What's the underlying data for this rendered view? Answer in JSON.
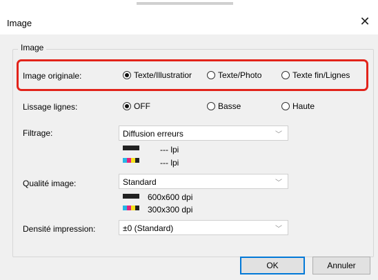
{
  "window": {
    "title": "Image",
    "close_glyph": "✕"
  },
  "group": {
    "title": "Image"
  },
  "image_originale": {
    "label": "Image originale:",
    "options": [
      {
        "label": "Texte/Illustratior",
        "selected": true
      },
      {
        "label": "Texte/Photo",
        "selected": false
      },
      {
        "label": "Texte fin/Lignes",
        "selected": false
      }
    ]
  },
  "lissage": {
    "label": "Lissage lignes:",
    "options": [
      {
        "label": "OFF",
        "selected": true
      },
      {
        "label": "Basse",
        "selected": false
      },
      {
        "label": "Haute",
        "selected": false
      }
    ]
  },
  "filtrage": {
    "label": "Filtrage:",
    "value": "Diffusion erreurs",
    "mono_lpi": "--- lpi",
    "color_lpi": "--- lpi"
  },
  "qualite": {
    "label": "Qualité image:",
    "value": "Standard",
    "mono_dpi": "600x600 dpi",
    "color_dpi": "300x300 dpi"
  },
  "densite": {
    "label": "Densité impression:",
    "value": "±0 (Standard)"
  },
  "buttons": {
    "ok": "OK",
    "cancel": "Annuler"
  },
  "colors": {
    "highlight": "#e2231a",
    "default_button_border": "#0078d7"
  }
}
